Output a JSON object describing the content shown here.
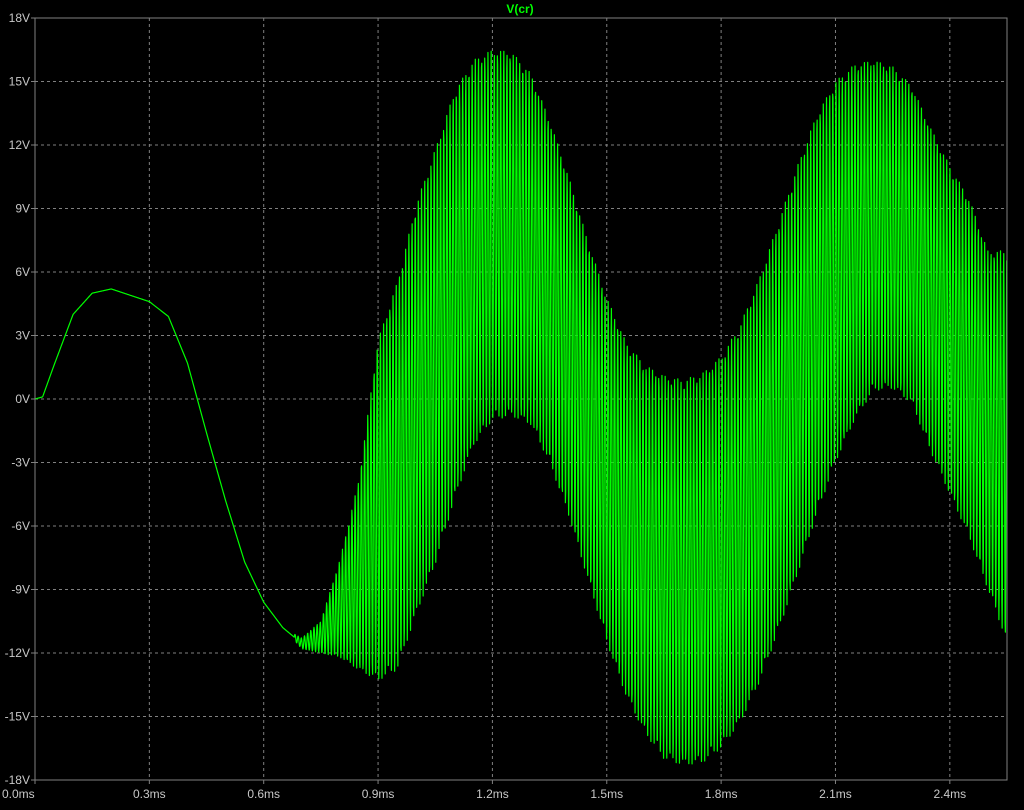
{
  "chart_data": {
    "type": "line",
    "title": "V(cr)",
    "xlabel": "",
    "ylabel": "",
    "x_unit": "ms",
    "y_unit": "V",
    "xlim": [
      0.0,
      2.55
    ],
    "ylim": [
      -18,
      18
    ],
    "x_ticks": [
      0.0,
      0.3,
      0.6,
      0.9,
      1.2,
      1.5,
      1.8,
      2.1,
      2.4
    ],
    "x_tick_labels": [
      "0.0ms",
      "0.3ms",
      "0.6ms",
      "0.9ms",
      "1.2ms",
      "1.5ms",
      "1.8ms",
      "2.1ms",
      "2.4ms"
    ],
    "y_ticks": [
      18,
      15,
      12,
      9,
      6,
      3,
      0,
      -3,
      -6,
      -9,
      -12,
      -15,
      -18
    ],
    "y_tick_labels": [
      "18V",
      "15V",
      "12V",
      "9V",
      "6V",
      "3V",
      "0V",
      "-3V",
      "-6V",
      "-9V",
      "-12V",
      "-15V",
      "-18V"
    ],
    "grid": true,
    "colors": {
      "background": "#000000",
      "axis": "#808080",
      "grid": "#808080",
      "trace": "#00ff00",
      "tick_text": "#c8c8c8",
      "title": "#00ff00"
    },
    "series": [
      {
        "name": "V(cr)",
        "color": "#00ff00",
        "envelope": {
          "x": [
            0.0,
            0.02,
            0.05,
            0.1,
            0.15,
            0.2,
            0.25,
            0.3,
            0.35,
            0.4,
            0.45,
            0.5,
            0.55,
            0.6,
            0.65,
            0.7,
            0.75,
            0.8,
            0.85,
            0.9,
            0.95,
            1.0,
            1.05,
            1.1,
            1.15,
            1.2,
            1.25,
            1.3,
            1.35,
            1.4,
            1.45,
            1.5,
            1.55,
            1.6,
            1.65,
            1.7,
            1.75,
            1.8,
            1.85,
            1.9,
            1.95,
            2.0,
            2.05,
            2.1,
            2.15,
            2.2,
            2.25,
            2.3,
            2.35,
            2.4,
            2.45,
            2.5,
            2.55
          ],
          "upper": [
            0.0,
            0.1,
            1.6,
            4.0,
            5.0,
            5.2,
            4.9,
            4.6,
            3.9,
            1.7,
            -1.6,
            -4.8,
            -7.7,
            -9.6,
            -10.8,
            -11.3,
            -10.5,
            -7.6,
            -3.8,
            2.8,
            5.5,
            9.2,
            11.8,
            14.5,
            16.0,
            16.5,
            16.4,
            15.4,
            13.2,
            10.5,
            7.5,
            4.8,
            2.7,
            1.6,
            1.1,
            0.9,
            1.2,
            2.0,
            3.5,
            5.7,
            8.3,
            11.0,
            13.4,
            15.0,
            15.8,
            16.0,
            15.7,
            14.8,
            12.8,
            11.0,
            9.5,
            7.0,
            7.0
          ],
          "lower": [
            0.0,
            0.1,
            1.6,
            4.0,
            5.0,
            5.2,
            4.9,
            4.6,
            3.9,
            1.7,
            -1.6,
            -4.8,
            -7.7,
            -9.6,
            -10.8,
            -11.8,
            -12.0,
            -12.2,
            -12.8,
            -13.3,
            -12.8,
            -10.2,
            -7.8,
            -4.8,
            -2.2,
            -1.0,
            -0.8,
            -1.2,
            -3.0,
            -5.5,
            -8.5,
            -11.5,
            -14.0,
            -15.8,
            -17.0,
            -17.3,
            -17.2,
            -16.5,
            -15.3,
            -13.4,
            -11.0,
            -8.3,
            -5.5,
            -3.0,
            -1.0,
            0.4,
            0.5,
            -0.2,
            -2.5,
            -4.5,
            -6.5,
            -9.0,
            -11.5
          ]
        },
        "oscillation_start_x": 0.68,
        "oscillation_period": 0.0083
      }
    ]
  }
}
